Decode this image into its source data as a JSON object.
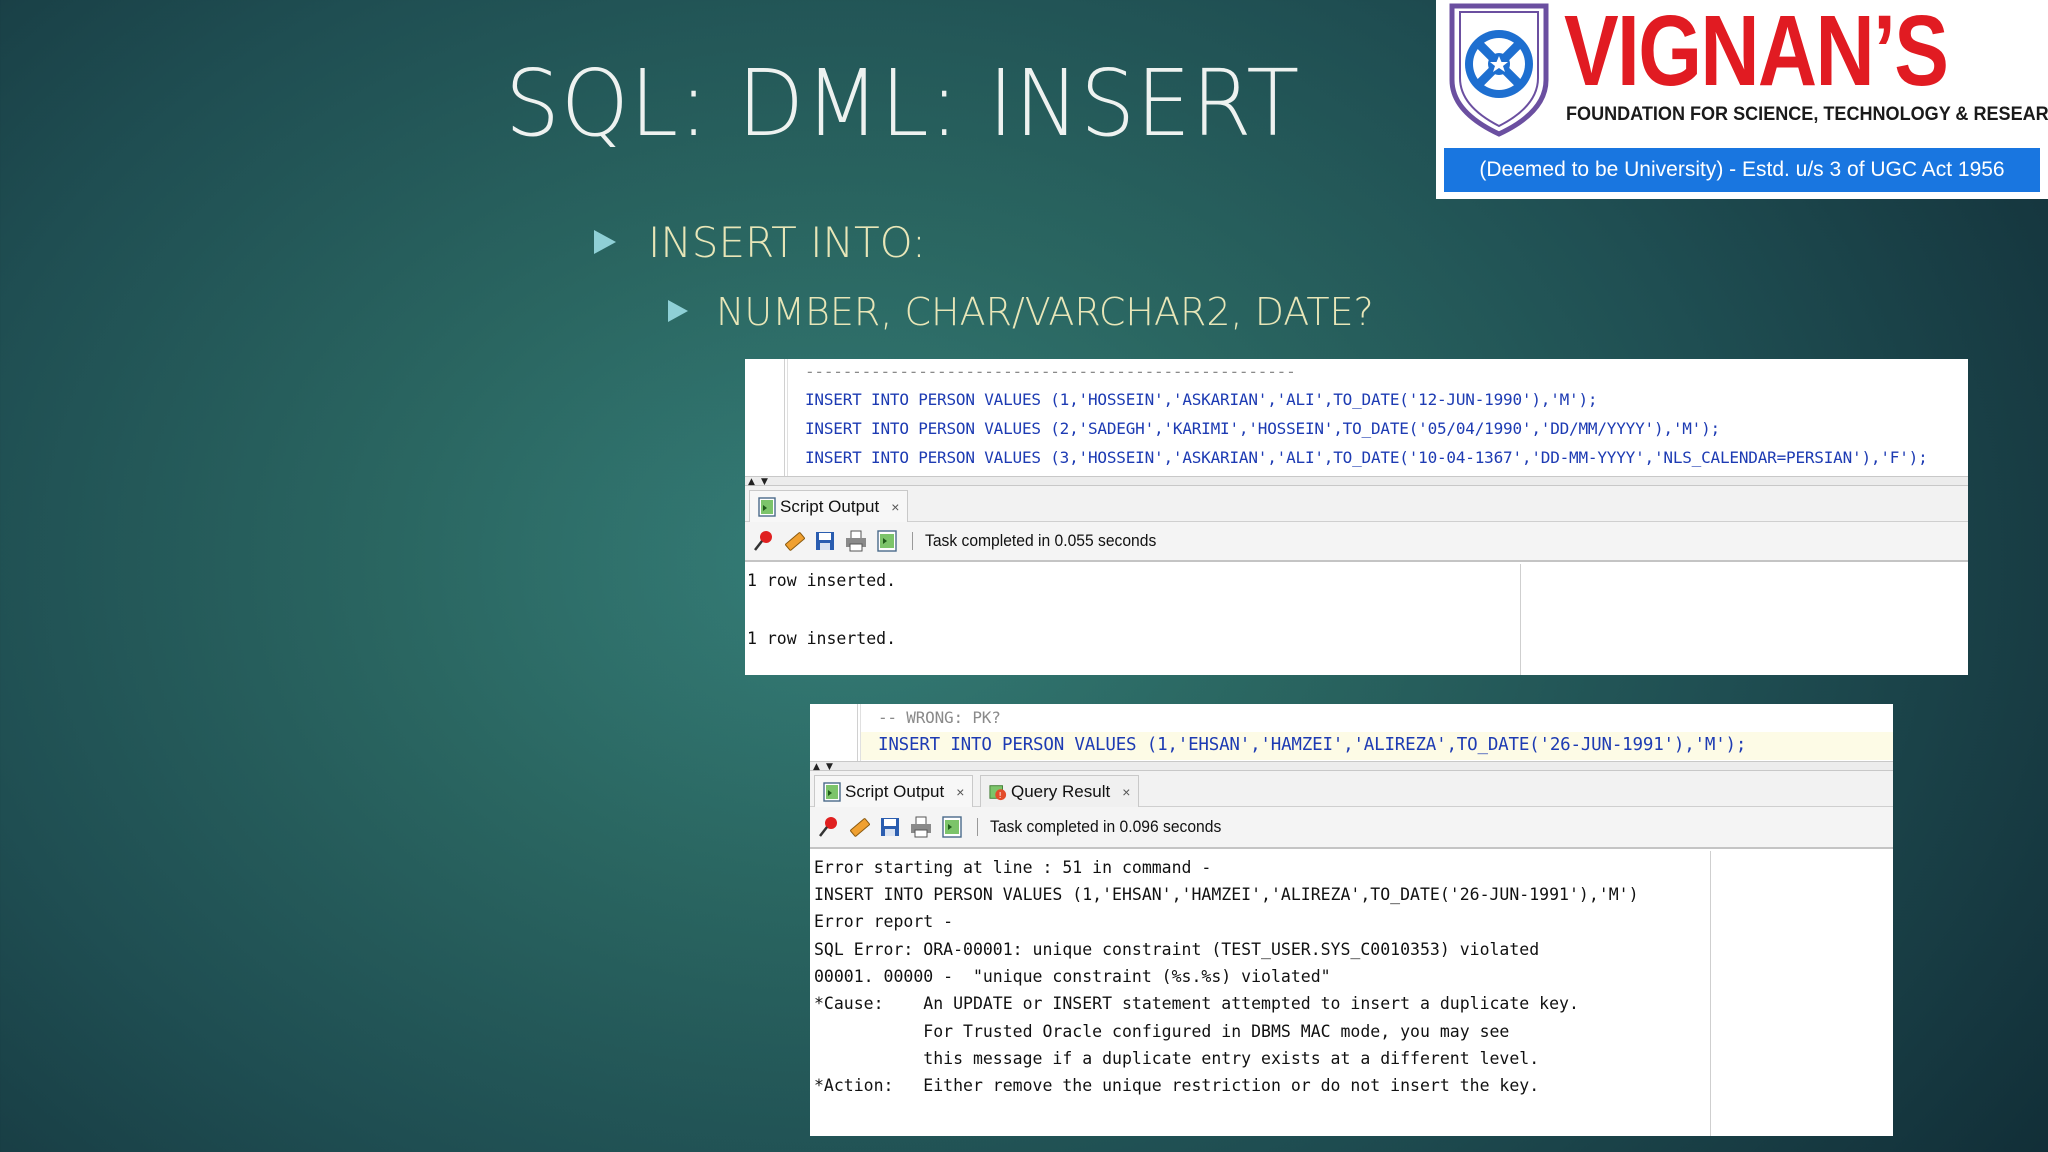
{
  "slide": {
    "title": "SQL: DML: INSERT",
    "bullet1": "INSERT INTO:",
    "bullet2": "NUMBER, CHAR/VARCHAR2, DATE?"
  },
  "logo": {
    "brand": "VIGNAN’S",
    "subtitle": "FOUNDATION FOR SCIENCE, TECHNOLOGY & RESEARCH",
    "banner": "(Deemed to be University) - Estd. u/s 3 of UGC Act 1956",
    "brand_color": "#e11b22",
    "banner_color": "#1976e0"
  },
  "panel1": {
    "comment_line": "----------------------------------------------------",
    "code_lines": [
      "INSERT INTO PERSON VALUES (1,'HOSSEIN','ASKARIAN','ALI',TO_DATE('12-JUN-1990'),'M');",
      "INSERT INTO PERSON VALUES (2,'SADEGH','KARIMI','HOSSEIN',TO_DATE('05/04/1990','DD/MM/YYYY'),'M');",
      "INSERT INTO PERSON VALUES (3,'HOSSEIN','ASKARIAN','ALI',TO_DATE('10-04-1367','DD-MM-YYYY','NLS_CALENDAR=PERSIAN'),'F');"
    ],
    "tab_label": "Script Output",
    "tab_close": "×",
    "status": "Task completed in 0.055 seconds",
    "output_lines": [
      "1 row inserted.",
      "",
      "1 row inserted."
    ]
  },
  "panel2": {
    "comment_line": "-- WRONG: PK?",
    "code_line": "INSERT INTO PERSON VALUES (1,'EHSAN','HAMZEI','ALIREZA',TO_DATE('26-JUN-1991'),'M');",
    "tab1_label": "Script Output",
    "tab2_label": "Query Result",
    "tab_close": "×",
    "status": "Task completed in 0.096 seconds",
    "output_lines": [
      "Error starting at line : 51 in command -",
      "INSERT INTO PERSON VALUES (1,'EHSAN','HAMZEI','ALIREZA',TO_DATE('26-JUN-1991'),'M')",
      "Error report -",
      "SQL Error: ORA-00001: unique constraint (TEST_USER.SYS_C0010353) violated",
      "00001. 00000 -  \"unique constraint (%s.%s) violated\"",
      "*Cause:    An UPDATE or INSERT statement attempted to insert a duplicate key.",
      "           For Trusted Oracle configured in DBMS MAC mode, you may see",
      "           this message if a duplicate entry exists at a different level.",
      "*Action:   Either remove the unique restriction or do not insert the key."
    ]
  },
  "icons": {
    "pin": "pin-icon",
    "eraser": "eraser-icon",
    "save": "save-icon",
    "print": "print-icon",
    "script": "script-output-icon",
    "query": "query-result-icon"
  }
}
